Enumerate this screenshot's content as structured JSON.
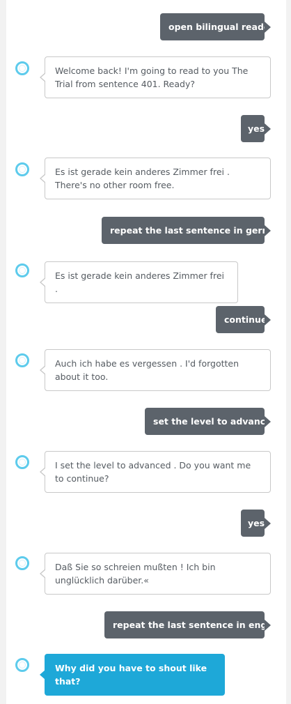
{
  "app": {
    "accent_color": "#1ea8d8",
    "user_bubble_color": "#5c636b",
    "assistant_icon": "alexa-ring-icon"
  },
  "conversation": [
    {
      "speaker": "user",
      "text": "open bilingual reader"
    },
    {
      "speaker": "alexa",
      "text": "Welcome back! I'm going to read to you The Trial from sentence 401. Ready?"
    },
    {
      "speaker": "user",
      "text": "yes"
    },
    {
      "speaker": "alexa",
      "text": "Es ist gerade kein anderes Zimmer frei . There's no other room free."
    },
    {
      "speaker": "user",
      "text": "repeat the last sentence in german"
    },
    {
      "speaker": "alexa",
      "text": "Es ist gerade kein anderes Zimmer frei ."
    },
    {
      "speaker": "user",
      "text": "continue"
    },
    {
      "speaker": "alexa",
      "text": "Auch ich habe es vergessen . I'd forgotten about it too."
    },
    {
      "speaker": "user",
      "text": "set the level to advanced"
    },
    {
      "speaker": "alexa",
      "text": "I set the level to advanced . Do you want me to continue?"
    },
    {
      "speaker": "user",
      "text": "yes"
    },
    {
      "speaker": "alexa",
      "text": "Daß Sie so schreien mußten ! Ich bin unglücklich darüber.«"
    },
    {
      "speaker": "user",
      "text": "repeat the last sentence in english"
    },
    {
      "speaker": "alexa",
      "text": "Why did you have to shout like that?",
      "active": true
    }
  ]
}
